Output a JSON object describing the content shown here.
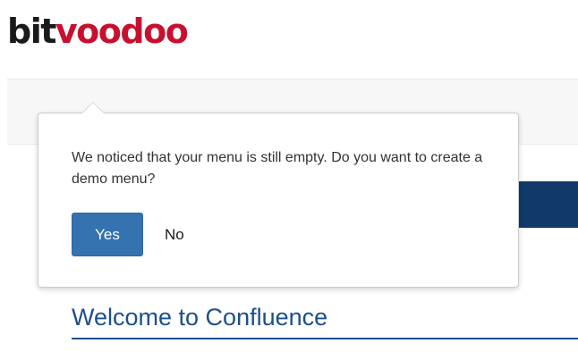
{
  "logo": {
    "part_dark": "bit",
    "part_red": "voodoo"
  },
  "popup": {
    "message": "We noticed that your menu is still empty. Do you want to create a demo menu?",
    "yes_label": "Yes",
    "no_label": "No"
  },
  "content": {
    "title": "Welcome to Confluence"
  },
  "colors": {
    "brand_red": "#c8102e",
    "nav_bar": "#113a6b",
    "primary_button": "#3572b0",
    "title_blue": "#1d4f8c"
  }
}
